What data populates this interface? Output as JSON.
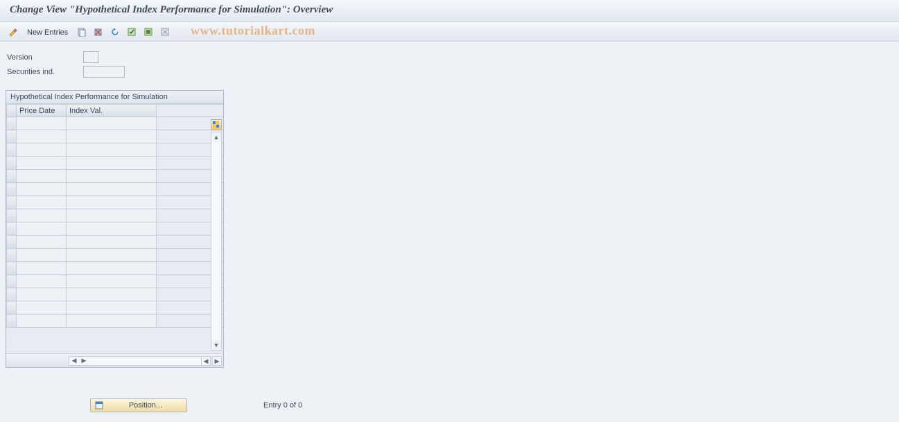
{
  "title": "Change View \"Hypothetical Index Performance for Simulation\": Overview",
  "toolbar": {
    "new_entries_label": "New Entries"
  },
  "watermark": "www.tutorialkart.com",
  "form": {
    "version_label": "Version",
    "version_value": "",
    "securities_label": "Securities ind.",
    "securities_value": ""
  },
  "panel": {
    "header": "Hypothetical Index Performance for Simulation",
    "columns": {
      "price_date": "Price Date",
      "index_val": "Index Val."
    },
    "rows": [
      {
        "price_date": "",
        "index_val": ""
      },
      {
        "price_date": "",
        "index_val": ""
      },
      {
        "price_date": "",
        "index_val": ""
      },
      {
        "price_date": "",
        "index_val": ""
      },
      {
        "price_date": "",
        "index_val": ""
      },
      {
        "price_date": "",
        "index_val": ""
      },
      {
        "price_date": "",
        "index_val": ""
      },
      {
        "price_date": "",
        "index_val": ""
      },
      {
        "price_date": "",
        "index_val": ""
      },
      {
        "price_date": "",
        "index_val": ""
      },
      {
        "price_date": "",
        "index_val": ""
      },
      {
        "price_date": "",
        "index_val": ""
      },
      {
        "price_date": "",
        "index_val": ""
      },
      {
        "price_date": "",
        "index_val": ""
      },
      {
        "price_date": "",
        "index_val": ""
      },
      {
        "price_date": "",
        "index_val": ""
      }
    ]
  },
  "footer": {
    "position_label": "Position...",
    "entry_text": "Entry 0 of 0"
  }
}
